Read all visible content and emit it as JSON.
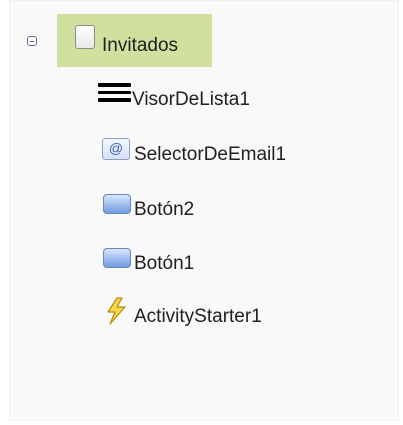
{
  "tree": {
    "root": {
      "label": "Invitados",
      "icon": "screen-icon",
      "expanded": true
    },
    "items": [
      {
        "label": "VisorDeLista1",
        "icon": "listview-icon"
      },
      {
        "label": "SelectorDeEmail1",
        "icon": "email-picker-icon",
        "icon_glyph": "@"
      },
      {
        "label": "Botón2",
        "icon": "button-icon"
      },
      {
        "label": "Botón1",
        "icon": "button-icon"
      },
      {
        "label": "ActivityStarter1",
        "icon": "lightning-bolt-icon"
      }
    ]
  },
  "colors": {
    "selection": "#d0e09f",
    "panel_bg": "#f9f9f9",
    "text": "#202020",
    "toggle": "#5a6f96"
  }
}
